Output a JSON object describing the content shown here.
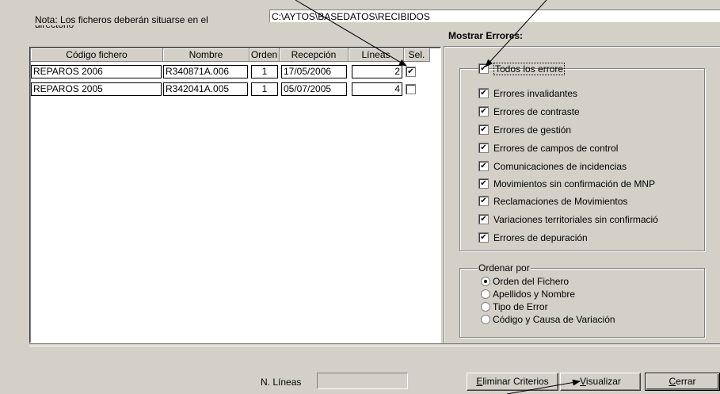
{
  "header": {
    "nota_label": "Nota: Los ficheros deberán situarse en el",
    "nota_clipped": "directorio",
    "path": "C:\\AYTOS\\BASEDATOS\\RECIBIDOS"
  },
  "errors": {
    "title": "Mostrar Errores:",
    "all_label": "Todos los errore",
    "all_checked": true,
    "options": [
      {
        "label": "Errores invalidantes",
        "checked": true
      },
      {
        "label": "Errores de contraste",
        "checked": true
      },
      {
        "label": "Errores de gestión",
        "checked": true
      },
      {
        "label": "Errores de campos de control",
        "checked": true
      },
      {
        "label": "Comunicaciones de incidencias",
        "checked": true
      },
      {
        "label": "Movimientos sin confirmación de MNP",
        "checked": true
      },
      {
        "label": "Reclamaciones de Movimientos",
        "checked": true
      },
      {
        "label": "Variaciones territoriales sin confirmació",
        "checked": true
      },
      {
        "label": "Errores de depuración",
        "checked": true
      }
    ]
  },
  "order": {
    "legend": "Ordenar por",
    "options": [
      {
        "label": "Orden del Fichero",
        "selected": true
      },
      {
        "label": "Apellidos y Nombre",
        "selected": false
      },
      {
        "label": "Tipo de Error",
        "selected": false
      },
      {
        "label": "Código y Causa de Variación",
        "selected": false
      }
    ]
  },
  "file_table": {
    "columns": [
      "Código fichero",
      "Nombre",
      "Orden",
      "Recepción",
      "Líneas",
      "Sel."
    ],
    "rows": [
      {
        "codigo": "REPAROS 2006",
        "nombre": "R340871A.006",
        "orden": "1",
        "recepcion": "17/05/2006",
        "lineas": "2",
        "sel": true
      },
      {
        "codigo": "REPAROS 2005",
        "nombre": "R342041A.005",
        "orden": "1",
        "recepcion": "05/07/2005",
        "lineas": "4",
        "sel": false
      }
    ]
  },
  "footer": {
    "n_lineas_label": "N. Líneas",
    "n_lineas_value": "",
    "buttons": {
      "eliminar": {
        "mnemonic": "E",
        "rest": "liminar Criterios"
      },
      "visualizar": {
        "mnemonic": "V",
        "rest": "isualizar"
      },
      "cerrar": {
        "mnemonic": "C",
        "rest": "errar"
      }
    }
  },
  "colors": {
    "face": "#d4d0c8",
    "shadow": "#808080",
    "highlight": "#ffffff"
  }
}
